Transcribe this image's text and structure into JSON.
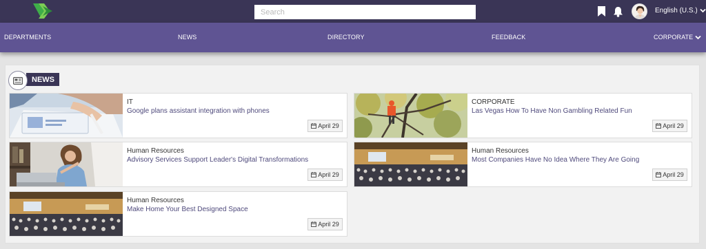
{
  "topbar": {
    "logo": "company-logo",
    "search": {
      "placeholder": "Search",
      "value": ""
    },
    "icons": [
      "bookmark-icon",
      "bell-icon"
    ],
    "avatar": "user-avatar",
    "language": "English (U.S.)"
  },
  "nav": {
    "items": [
      {
        "label": "DEPARTMENTS"
      },
      {
        "label": "NEWS"
      },
      {
        "label": "DIRECTORY"
      },
      {
        "label": "FEEDBACK"
      },
      {
        "label": "CORPORATE"
      }
    ]
  },
  "news": {
    "heading": "NEWS",
    "icon": "newspaper-icon",
    "cards": [
      {
        "category": "IT",
        "title": "Google plans assistant integration with phones",
        "date": "April 29",
        "thumb": "tablet-stylus-photo"
      },
      {
        "category": "CORPORATE",
        "title": "Las Vegas How To Have Non Gambling Related Fun",
        "date": "April 29",
        "thumb": "tree-climber-photo"
      },
      {
        "category": "Human Resources",
        "title": "Advisory Services Support Leader's Digital Transformations",
        "date": "April 29",
        "thumb": "woman-laptop-photo"
      },
      {
        "category": "Human Resources",
        "title": "Most Companies Have No Idea Where They Are Going",
        "date": "April 29",
        "thumb": "conference-hall-photo"
      },
      {
        "category": "Human Resources",
        "title": "Make Home Your Best Designed Space",
        "date": "April 29",
        "thumb": "conference-hall-photo"
      }
    ]
  },
  "colors": {
    "topbar": "#3a3556",
    "navbar": "#5f5493",
    "accent_text": "#4f4a7c"
  }
}
